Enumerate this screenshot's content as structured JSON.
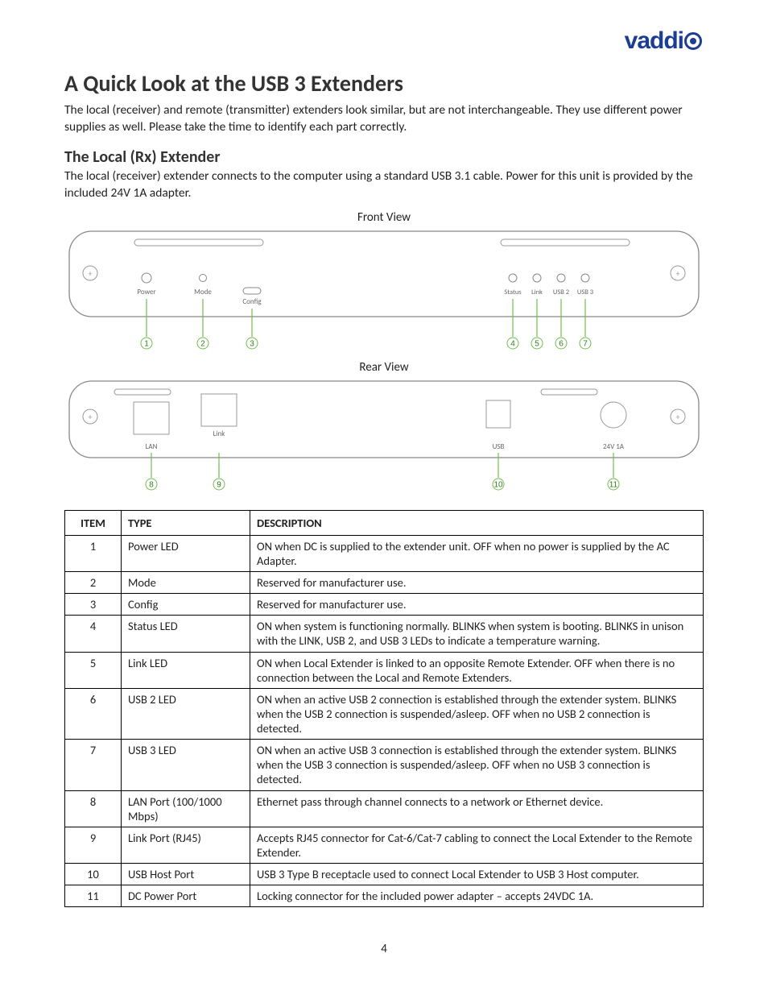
{
  "brand": "vaddi",
  "h1": "A Quick Look at the USB 3 Extenders",
  "intro": "The local (receiver) and remote (transmitter) extenders look similar, but are not interchangeable. They use different power supplies as well. Please take the time to identify each part correctly.",
  "h2": "The Local (Rx) Extender",
  "sub": "The local (receiver) extender connects to the computer using a standard USB 3.1 cable. Power for this unit is provided by the included 24V 1A adapter.",
  "caption_front": "Front View",
  "caption_rear": "Rear View",
  "front_labels": {
    "power": "Power",
    "mode": "Mode",
    "config": "Config",
    "status": "Status",
    "link": "Link",
    "usb2": "USB 2",
    "usb3": "USB 3"
  },
  "rear_labels": {
    "lan": "LAN",
    "link": "Link",
    "usb": "USB",
    "power": "24V 1A"
  },
  "callouts": {
    "c1": "1",
    "c2": "2",
    "c3": "3",
    "c4": "4",
    "c5": "5",
    "c6": "6",
    "c7": "7",
    "c8": "8",
    "c9": "9",
    "c10": "10",
    "c11": "11"
  },
  "table": {
    "headers": {
      "item": "ITEM",
      "type": "TYPE",
      "desc": "DESCRIPTION"
    },
    "rows": [
      {
        "item": "1",
        "type": "Power LED",
        "desc": "ON when DC is supplied to the extender unit. OFF when no power is supplied by the AC Adapter."
      },
      {
        "item": "2",
        "type": "Mode",
        "desc": "Reserved for manufacturer use."
      },
      {
        "item": "3",
        "type": "Config",
        "desc": "Reserved for manufacturer use."
      },
      {
        "item": "4",
        "type": "Status LED",
        "desc": "ON when system is functioning normally. BLINKS when system is booting. BLINKS in unison with the LINK, USB 2, and USB 3 LEDs to indicate a temperature warning."
      },
      {
        "item": "5",
        "type": "Link LED",
        "desc": "ON when Local Extender is linked to an opposite Remote Extender. OFF when there is no connection between the Local and Remote Extenders."
      },
      {
        "item": "6",
        "type": "USB 2 LED",
        "desc": "ON when an active USB 2 connection is established through the extender system. BLINKS when the USB 2 connection is suspended/asleep. OFF when no USB 2 connection is detected."
      },
      {
        "item": "7",
        "type": "USB 3 LED",
        "desc": "ON when an active USB 3 connection is established through the extender system. BLINKS when the USB 3 connection is suspended/asleep. OFF when no USB 3 connection is detected."
      },
      {
        "item": "8",
        "type": "LAN Port (100/1000 Mbps)",
        "desc": "Ethernet pass through channel connects to a network or Ethernet device."
      },
      {
        "item": "9",
        "type": "Link Port (RJ45)",
        "desc": "Accepts RJ45 connector for Cat-6/Cat-7 cabling to connect the Local Extender to the Remote Extender."
      },
      {
        "item": "10",
        "type": "USB Host Port",
        "desc": "USB 3 Type B receptacle used to connect Local Extender to USB 3 Host computer."
      },
      {
        "item": "11",
        "type": "DC Power Port",
        "desc": "Locking connector for the included power adapter – accepts 24VDC 1A."
      }
    ]
  },
  "page_number": "4"
}
